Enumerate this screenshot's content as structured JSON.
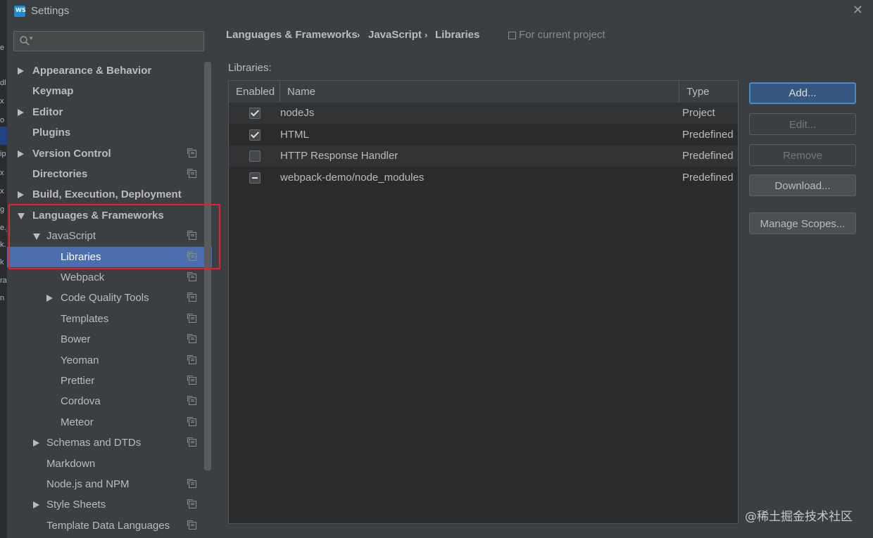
{
  "window": {
    "title": "Settings",
    "app_icon_text": "WS"
  },
  "background_glyphs": [
    "e",
    "dl",
    "x",
    "o",
    "ip",
    "x",
    "x",
    "g",
    "e.j",
    "k.",
    "k",
    "ra",
    "n"
  ],
  "search": {
    "placeholder": "Q▾"
  },
  "tree": [
    {
      "label": "Appearance & Behavior",
      "level": 0,
      "expander": "right",
      "bold": true,
      "scope": false,
      "selected": false
    },
    {
      "label": "Keymap",
      "level": 0,
      "expander": "none",
      "bold": true,
      "scope": false,
      "selected": false
    },
    {
      "label": "Editor",
      "level": 0,
      "expander": "right",
      "bold": true,
      "scope": false,
      "selected": false
    },
    {
      "label": "Plugins",
      "level": 0,
      "expander": "none",
      "bold": true,
      "scope": false,
      "selected": false
    },
    {
      "label": "Version Control",
      "level": 0,
      "expander": "right",
      "bold": true,
      "scope": true,
      "selected": false
    },
    {
      "label": "Directories",
      "level": 0,
      "expander": "none",
      "bold": true,
      "scope": true,
      "selected": false
    },
    {
      "label": "Build, Execution, Deployment",
      "level": 0,
      "expander": "right",
      "bold": true,
      "scope": false,
      "selected": false
    },
    {
      "label": "Languages & Frameworks",
      "level": 0,
      "expander": "down",
      "bold": true,
      "scope": false,
      "selected": false
    },
    {
      "label": "JavaScript",
      "level": 1,
      "expander": "down",
      "bold": false,
      "scope": true,
      "selected": false
    },
    {
      "label": "Libraries",
      "level": 2,
      "expander": "none",
      "bold": false,
      "scope": true,
      "selected": true
    },
    {
      "label": "Webpack",
      "level": 2,
      "expander": "none",
      "bold": false,
      "scope": true,
      "selected": false
    },
    {
      "label": "Code Quality Tools",
      "level": 2,
      "expander": "right",
      "bold": false,
      "scope": true,
      "selected": false
    },
    {
      "label": "Templates",
      "level": 2,
      "expander": "none",
      "bold": false,
      "scope": true,
      "selected": false
    },
    {
      "label": "Bower",
      "level": 2,
      "expander": "none",
      "bold": false,
      "scope": true,
      "selected": false
    },
    {
      "label": "Yeoman",
      "level": 2,
      "expander": "none",
      "bold": false,
      "scope": true,
      "selected": false
    },
    {
      "label": "Prettier",
      "level": 2,
      "expander": "none",
      "bold": false,
      "scope": true,
      "selected": false
    },
    {
      "label": "Cordova",
      "level": 2,
      "expander": "none",
      "bold": false,
      "scope": true,
      "selected": false
    },
    {
      "label": "Meteor",
      "level": 2,
      "expander": "none",
      "bold": false,
      "scope": true,
      "selected": false
    },
    {
      "label": "Schemas and DTDs",
      "level": 1,
      "expander": "right",
      "bold": false,
      "scope": true,
      "selected": false
    },
    {
      "label": "Markdown",
      "level": 1,
      "expander": "none",
      "bold": false,
      "scope": false,
      "selected": false
    },
    {
      "label": "Node.js and NPM",
      "level": 1,
      "expander": "none",
      "bold": false,
      "scope": true,
      "selected": false
    },
    {
      "label": "Style Sheets",
      "level": 1,
      "expander": "right",
      "bold": false,
      "scope": true,
      "selected": false
    },
    {
      "label": "Template Data Languages",
      "level": 1,
      "expander": "none",
      "bold": false,
      "scope": true,
      "selected": false
    }
  ],
  "breadcrumb": {
    "items": [
      "Languages & Frameworks",
      "JavaScript",
      "Libraries"
    ],
    "separator": "›",
    "scope_note": "For current project"
  },
  "libraries": {
    "label": "Libraries:",
    "columns": [
      "Enabled",
      "Name",
      "Type"
    ],
    "rows": [
      {
        "enabled": "checked",
        "name": "nodeJs",
        "type": "Project"
      },
      {
        "enabled": "checked",
        "name": "HTML",
        "type": "Predefined"
      },
      {
        "enabled": "unchecked",
        "name": "HTTP Response Handler",
        "type": "Predefined"
      },
      {
        "enabled": "partial",
        "name": "webpack-demo/node_modules",
        "type": "Predefined"
      }
    ]
  },
  "buttons": {
    "add": "Add...",
    "edit": "Edit...",
    "remove": "Remove",
    "download": "Download...",
    "manage_scopes": "Manage Scopes..."
  },
  "watermark": "@稀土掘金技术社区",
  "colors": {
    "background": "#3c3f41",
    "selection": "#4b6eaf",
    "highlight_box": "#e5232e",
    "table_bg": "#2b2b2b"
  }
}
